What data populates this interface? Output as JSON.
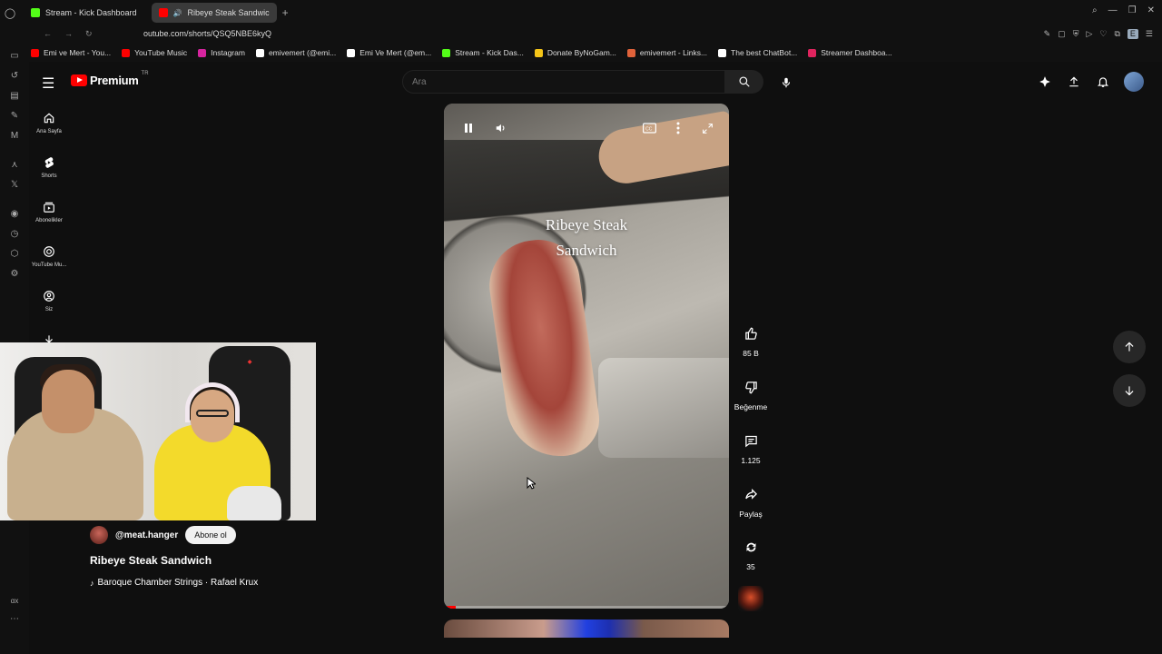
{
  "browser": {
    "tabs": [
      {
        "label": "Stream - Kick Dashboard",
        "active": false
      },
      {
        "label": "Ribeye Steak Sandwic",
        "active": true
      }
    ],
    "url": "outube.com/shorts/QSQ5NBE6kyQ",
    "bookmarks": [
      {
        "label": "Emi ve Mert - You...",
        "color": "#ff0000"
      },
      {
        "label": "YouTube Music",
        "color": "#ff0000"
      },
      {
        "label": "Instagram",
        "color": "#d6249f"
      },
      {
        "label": "emivemert (@emi...",
        "color": "#ffffff"
      },
      {
        "label": "Emi Ve Mert (@em...",
        "color": "#ffffff"
      },
      {
        "label": "Stream - Kick Das...",
        "color": "#53fc18"
      },
      {
        "label": "Donate ByNoGam...",
        "color": "#f5c518"
      },
      {
        "label": "emivemert - Links...",
        "color": "#e0623a"
      },
      {
        "label": "The best ChatBot...",
        "color": "#ffffff"
      },
      {
        "label": "Streamer Dashboa...",
        "color": "#e0245e"
      }
    ]
  },
  "header": {
    "logo_text": "Premium",
    "logo_region": "TR",
    "search_placeholder": "Ara"
  },
  "sidebar": {
    "items": [
      {
        "label": "Ana Sayfa",
        "icon": "home-icon"
      },
      {
        "label": "Shorts",
        "icon": "shorts-icon"
      },
      {
        "label": "Abonelikler",
        "icon": "subscriptions-icon"
      },
      {
        "label": "YouTube Mu...",
        "icon": "youtube-music-icon"
      },
      {
        "label": "Siz",
        "icon": "you-icon"
      }
    ]
  },
  "short": {
    "overlay_title_line1": "Ribeye Steak",
    "overlay_title_line2": "Sandwich",
    "channel": "@meat.hanger",
    "subscribe_label": "Abone ol",
    "title": "Ribeye Steak Sandwich",
    "music": "Baroque Chamber Strings · Rafael Krux",
    "progress": 0.04
  },
  "actions": {
    "likes": "85 B",
    "dislike_label": "Beğenme",
    "comments": "1.125",
    "share_label": "Paylaş",
    "remix_count": "35"
  },
  "edge_rail": {
    "bottom_label": "αx"
  }
}
